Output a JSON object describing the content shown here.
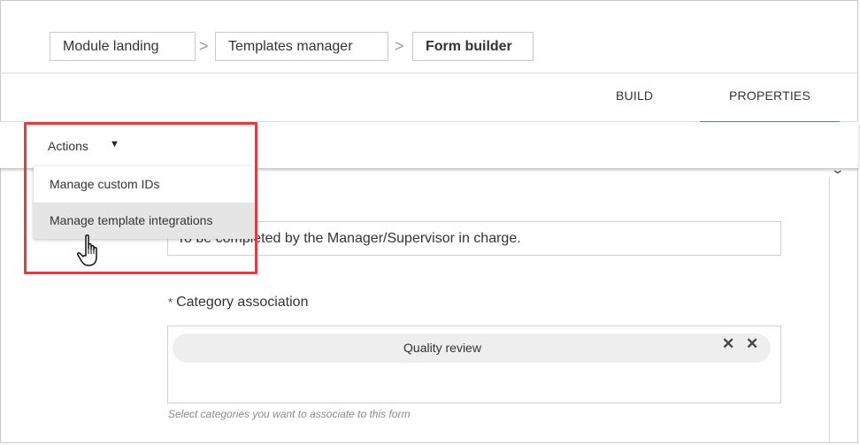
{
  "breadcrumb": {
    "items": [
      "Module landing",
      "Templates manager",
      "Form builder"
    ],
    "separator": ">"
  },
  "tabs": [
    "BUILD",
    "PROPERTIES"
  ],
  "active_tab": "PROPERTIES",
  "actions": {
    "label": "Actions",
    "caret": "▼",
    "menu": [
      "Manage custom IDs",
      "Manage template integrations"
    ],
    "hovered_item": "Manage template integrations"
  },
  "form": {
    "description_value": "To be completed by the Manager/Supervisor in charge.",
    "category_required_marker": "*",
    "category_label": "Category association",
    "category_chip": "Quality review",
    "chip_remove": "✕",
    "clear_all": "✕",
    "category_hint": "Select categories you want to associate to this form",
    "collapse_glyph": "⌄"
  },
  "colors": {
    "highlight": "#e53a40",
    "tab_active": "#3c8dbc",
    "menu_hover": "#e5e5e5"
  },
  "icons": {
    "cursor": "hand-pointer-icon",
    "caret": "caret-down-icon",
    "collapse": "chevron-down-icon"
  }
}
